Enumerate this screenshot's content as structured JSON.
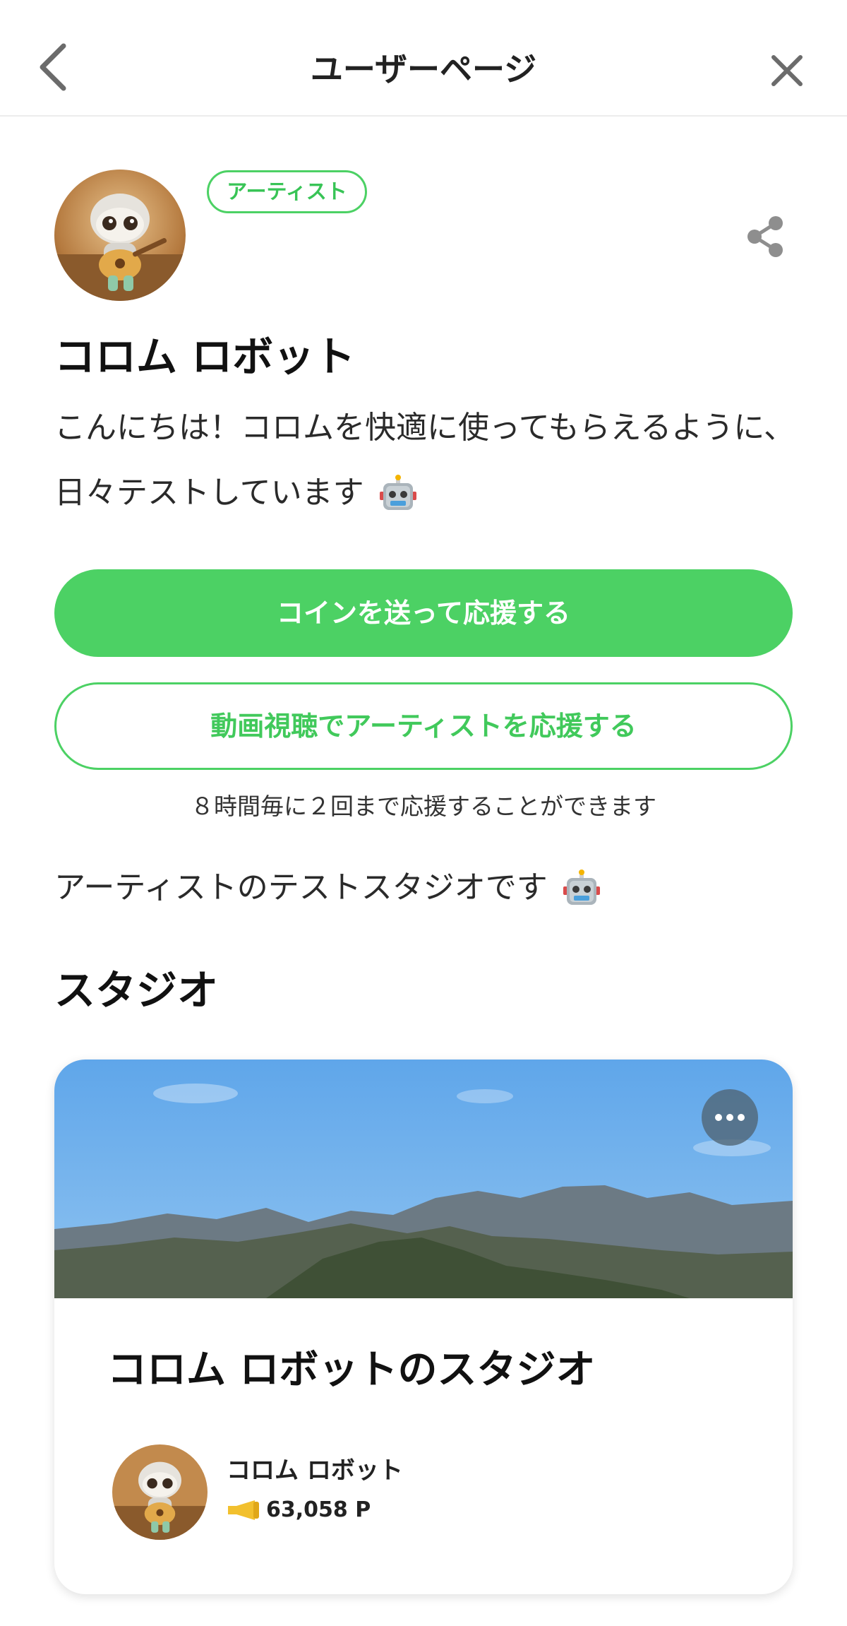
{
  "header": {
    "title": "ユーザーページ"
  },
  "profile": {
    "badge": "アーティスト",
    "name": "コロム ロボット",
    "bio": "こんにちは！コロムを快適に使ってもらえるように、日々テストしています",
    "avatar": "robot-guitar-avatar"
  },
  "actions": {
    "coin_button": "コインを送って応援する",
    "video_button": "動画視聴でアーティストを応援する",
    "note": "８時間毎に２回まで応援することができます"
  },
  "studio_description": "アーティストのテストスタジオです",
  "studio_section": {
    "title": "スタジオ",
    "card": {
      "title": "コロム ロボットのスタジオ",
      "owner": "コロム ロボット",
      "points": "63,058 P"
    }
  },
  "icons": {
    "back": "chevron-left-icon",
    "close": "close-icon",
    "share": "share-icon",
    "more": "more-horizontal-icon",
    "emoji": "robot-face-emoji",
    "points": "megaphone-icon"
  },
  "colors": {
    "accent": "#4cd164",
    "accent_text": "#38c456"
  }
}
